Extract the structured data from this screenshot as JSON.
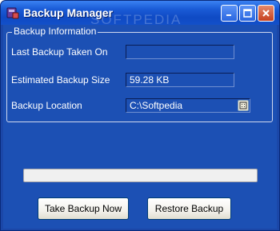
{
  "window": {
    "title": "Backup Manager",
    "watermark": "SOFTPEDIA",
    "controls": {
      "minimize": "minimize-icon",
      "maximize": "maximize-icon",
      "close": "close-icon"
    }
  },
  "group": {
    "legend": "Backup Information",
    "rows": [
      {
        "label": "Last Backup Taken On",
        "value": ""
      },
      {
        "label": "Estimated Backup Size",
        "value": "59.28 KB"
      },
      {
        "label": "Backup Location",
        "value": "C:\\Softpedia"
      }
    ]
  },
  "progress": {
    "value": 0
  },
  "buttons": {
    "take_backup": "Take Backup Now",
    "restore": "Restore Backup"
  },
  "colors": {
    "titlebar": "#0f4ac4",
    "client": "#1c50b4",
    "close": "#c6401f"
  }
}
